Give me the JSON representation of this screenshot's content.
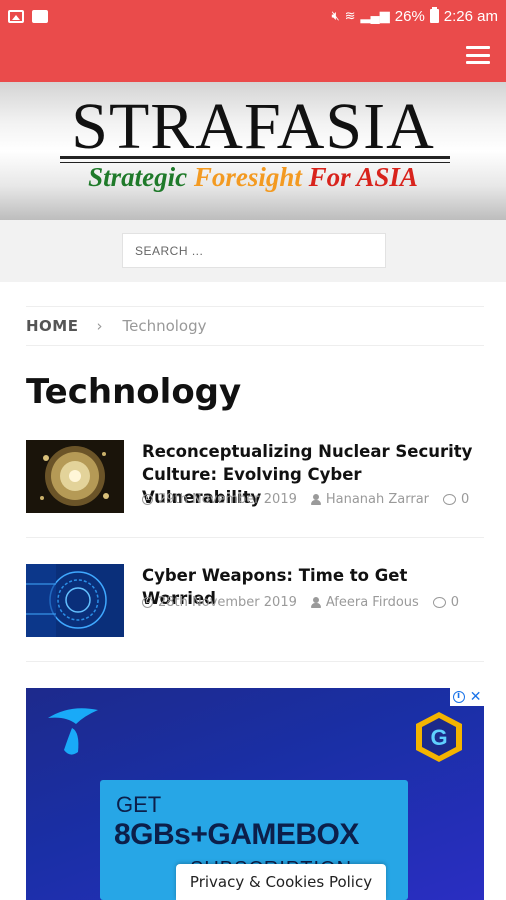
{
  "status_bar": {
    "battery_percent": "26%",
    "time": "2:26 am",
    "icons": [
      "image-icon",
      "message-icon",
      "mute-icon",
      "wifi-icon",
      "signal-icon",
      "battery-icon"
    ]
  },
  "header": {
    "menu_icon": "hamburger-icon",
    "bg_color": "#ea4b4b"
  },
  "logo": {
    "name": "STRAFASIA",
    "tagline": {
      "strategic": "Strategic",
      "foresight": "Foresight",
      "for_asia": "For ASIA"
    },
    "colors": {
      "green": "#1f7a2a",
      "orange": "#f39a21",
      "red": "#d8231c"
    }
  },
  "search": {
    "placeholder": "SEARCH ..."
  },
  "breadcrumb": {
    "home": "HOME",
    "separator": "›",
    "current": "Technology"
  },
  "page": {
    "title": "Technology"
  },
  "articles": [
    {
      "title": "Reconceptualizing Nuclear Security Culture: Evolving Cyber Vulnerability",
      "date": "29th November 2019",
      "author": "Hananah Zarrar",
      "comments": "0"
    },
    {
      "title": "Cyber Weapons: Time to Get Worried",
      "date": "28th November 2019",
      "author": "Afeera Firdous",
      "comments": "0"
    }
  ],
  "ad": {
    "get": "GET",
    "headline": "8GBs+GAMEBOX",
    "sub": "SUBSCRIPTION",
    "info_icon": "i",
    "close_icon": "✕"
  },
  "cookies": {
    "label": "Privacy & Cookies Policy"
  }
}
